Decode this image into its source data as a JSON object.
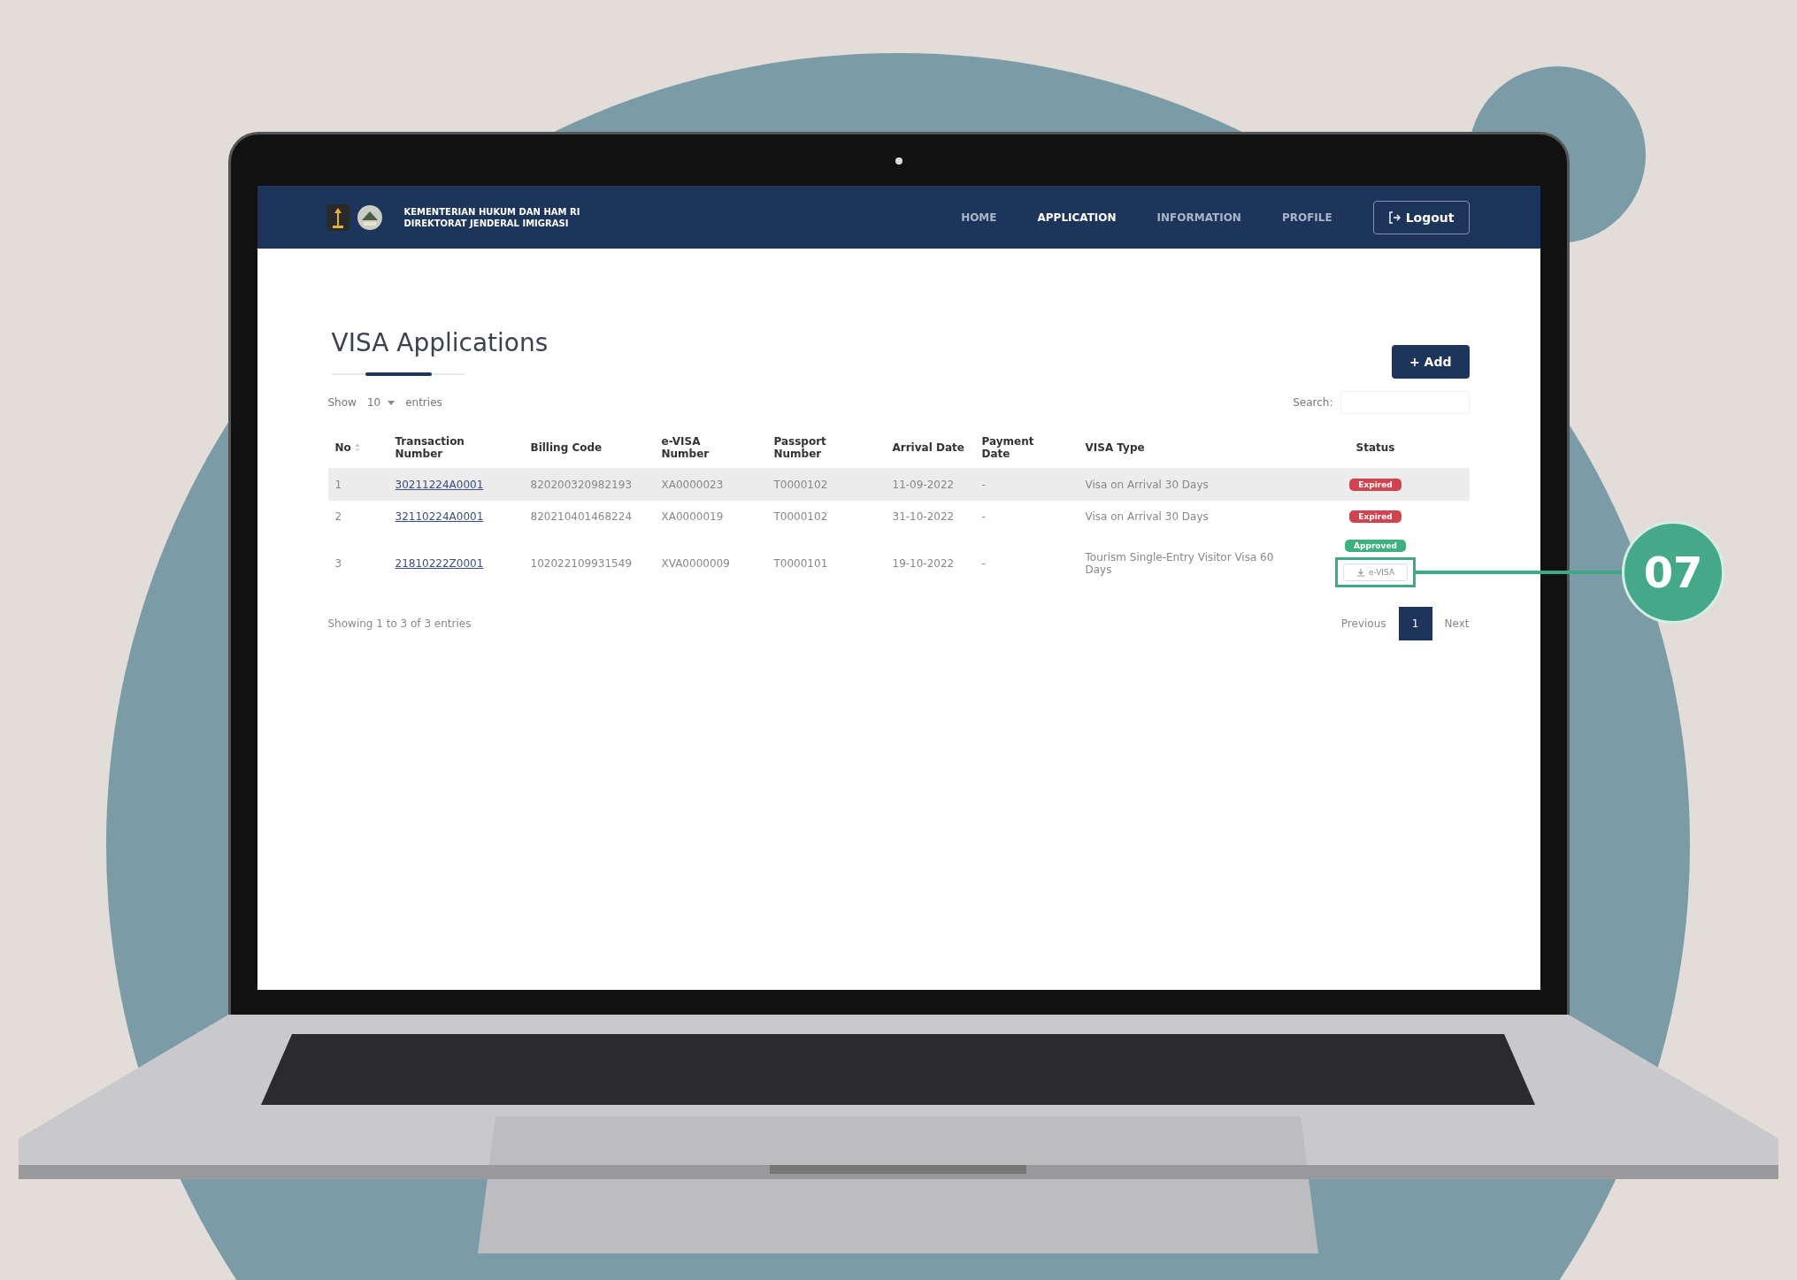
{
  "header": {
    "agency_lines": [
      "KEMENTERIAN HUKUM DAN HAM RI",
      "DIREKTORAT JENDERAL IMIGRASI"
    ],
    "nav": [
      {
        "label": "HOME",
        "selected": false
      },
      {
        "label": "APPLICATION",
        "selected": true
      },
      {
        "label": "INFORMATION",
        "selected": false
      },
      {
        "label": "PROFILE",
        "selected": false
      }
    ],
    "logout": "Logout"
  },
  "page": {
    "title": "VISA Applications",
    "add_button": "+ Add",
    "show_label": "Show",
    "page_size": "10",
    "entries_label": "entries",
    "search_label": "Search:"
  },
  "table": {
    "columns": [
      "No",
      "Transaction Number",
      "Billing Code",
      "e-VISA Number",
      "Passport Number",
      "Arrival Date",
      "Payment Date",
      "VISA Type",
      "Status"
    ],
    "rows": [
      {
        "selected": true,
        "cells": [
          "1",
          "30211224A0001",
          "820200320982193",
          "XA0000023",
          "T0000102",
          "11-09-2022",
          "-",
          "Visa on Arrival 30 Days"
        ],
        "status": [
          {
            "kind": "badge",
            "label": "Expired",
            "color": "#d4424f"
          }
        ]
      },
      {
        "selected": false,
        "cells": [
          "2",
          "32110224A0001",
          "820210401468224",
          "XA0000019",
          "T0000102",
          "31-10-2022",
          "-",
          "Visa on Arrival 30 Days"
        ],
        "status": [
          {
            "kind": "badge",
            "label": "Expired",
            "color": "#d4424f"
          }
        ]
      },
      {
        "selected": false,
        "cells": [
          "3",
          "21810222Z0001",
          "102022109931549",
          "XVA0000009",
          "T0000101",
          "19-10-2022",
          "-",
          "Tourism Single-Entry Visitor Visa 60 Days"
        ],
        "status": [
          {
            "kind": "badge",
            "label": "Approved",
            "color": "#3fb07f"
          },
          {
            "kind": "button",
            "label": "e-VISA"
          }
        ],
        "callout": "07"
      }
    ]
  },
  "footer": {
    "summary": "Showing 1 to 3 of 3 entries",
    "previous": "Previous",
    "pages": [
      {
        "label": "1",
        "selected": true
      }
    ],
    "next": "Next"
  }
}
